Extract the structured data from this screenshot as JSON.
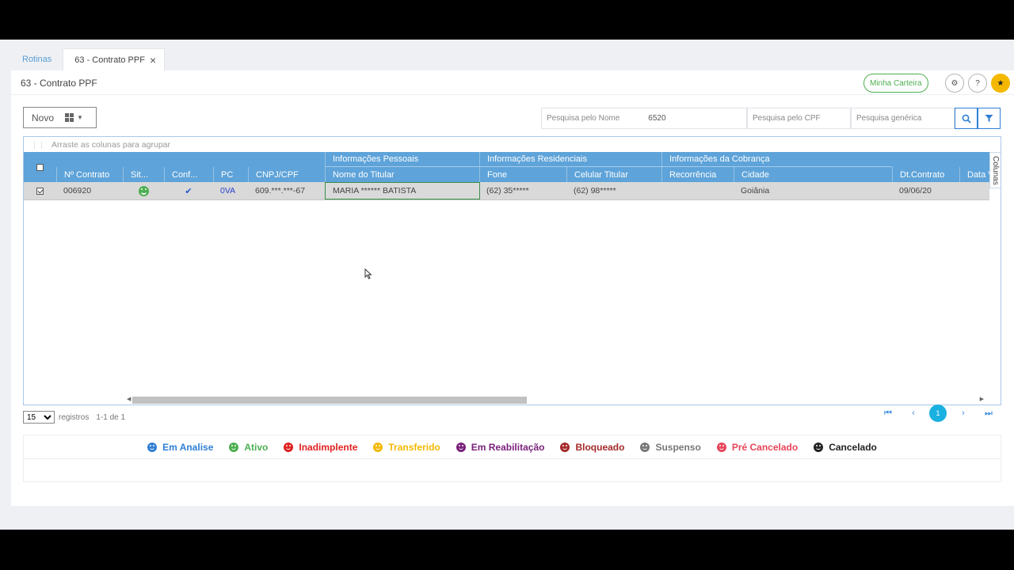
{
  "tabs": [
    {
      "label": "Rotinas",
      "active": false
    },
    {
      "label": "63 - Contrato PPF",
      "active": true
    }
  ],
  "page": {
    "title": "63 - Contrato PPF"
  },
  "header_actions": {
    "wallet_label": "Minha Carteira",
    "icons": [
      "gear-icon",
      "help-icon",
      "star-icon"
    ]
  },
  "toolbar": {
    "novo_label": "Novo"
  },
  "search": {
    "name_placeholder": "Pesquisa pelo Nome",
    "name_value": "6520",
    "cpf_placeholder": "Pesquisa pelo CPF",
    "generic_placeholder": "Pesquisa genérica"
  },
  "grid": {
    "group_hint": "Arraste as colunas para agrupar",
    "group_headers": [
      "Informações Pessoais",
      "Informações Residenciais",
      "Informações da Cobrança"
    ],
    "columns": [
      "Nº Contrato",
      "Sit...",
      "Conf...",
      "PC",
      "CNPJ/CPF",
      "Nome do Titular",
      "Fone",
      "Celular Titular",
      "Recorrência",
      "Cidade",
      "Dt.Contrato",
      "Data V"
    ],
    "rows": [
      {
        "checked": true,
        "contrato": "006920",
        "situacao_icon": "smile-icon",
        "conf_icon": "check-icon",
        "pc": "0VA",
        "cpf": "609.***.***-67",
        "nome": "MARIA ****** BATISTA",
        "fone": "(62) 35*****",
        "celular": "(62) 98*****",
        "recorrencia": "",
        "cidade": "Goiânia",
        "dt_contrato": "09/06/20"
      }
    ],
    "colunas_label": "Colunas"
  },
  "pager": {
    "page_size": "15",
    "registros_label": "registros",
    "range_text": "1-1 de 1",
    "current_page": "1"
  },
  "legend": [
    {
      "label": "Em Analise",
      "color": "#2f7fd6"
    },
    {
      "label": "Ativo",
      "color": "#4caf50"
    },
    {
      "label": "Inadimplente",
      "color": "#e02020"
    },
    {
      "label": "Transferido",
      "color": "#f5b800"
    },
    {
      "label": "Em Reabilitação",
      "color": "#7a1f7a"
    },
    {
      "label": "Bloqueado",
      "color": "#a52a2a"
    },
    {
      "label": "Suspenso",
      "color": "#777777"
    },
    {
      "label": "Pré Cancelado",
      "color": "#e8455a"
    },
    {
      "label": "Cancelado",
      "color": "#222222"
    }
  ]
}
